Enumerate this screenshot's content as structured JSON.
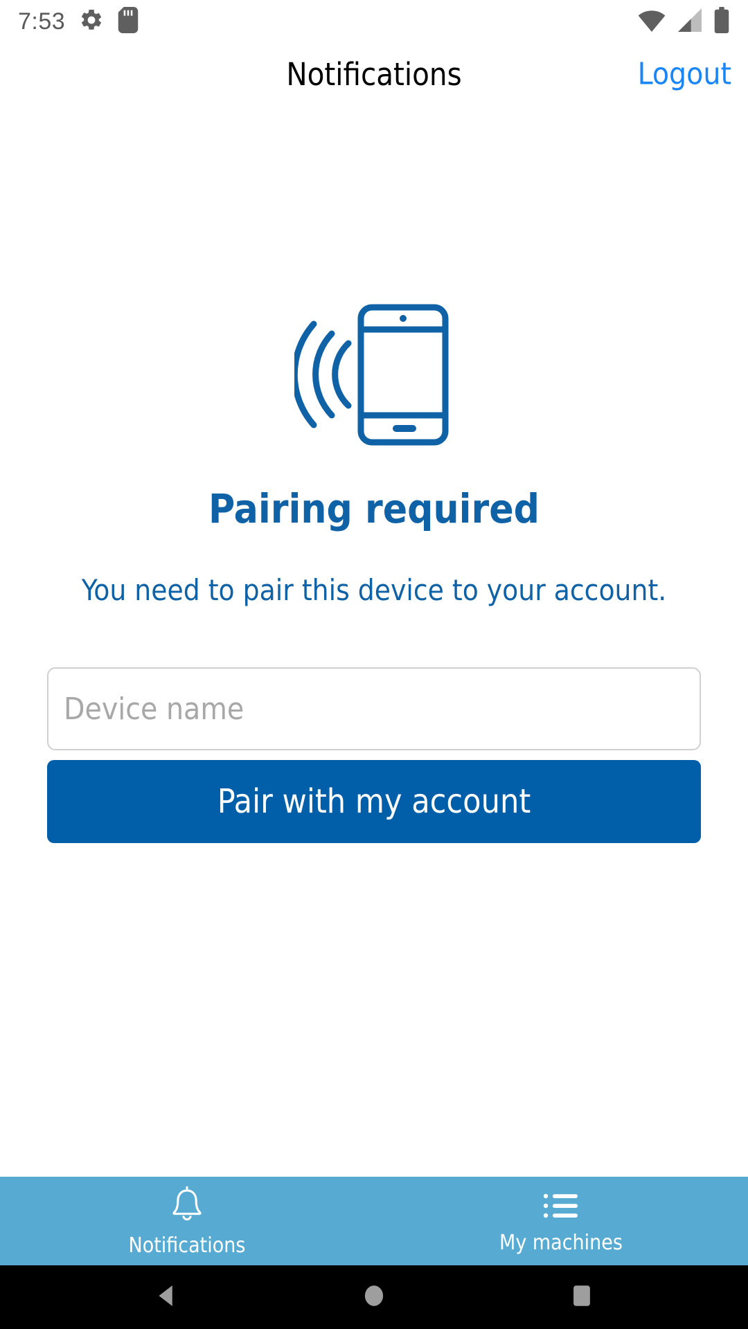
{
  "status_bar": {
    "time": "7:53",
    "icons": [
      "gear-icon",
      "sd-card-icon",
      "wifi-icon",
      "cellular-signal-icon",
      "battery-icon"
    ]
  },
  "header": {
    "title": "Notifications",
    "logout_label": "Logout",
    "logout_color": "#1886f7"
  },
  "main": {
    "illustration": "phone-with-signal-waves-icon",
    "headline": "Pairing required",
    "subtext": "You need to pair this device to your account.",
    "device_name_value": "",
    "device_name_placeholder": "Device name",
    "pair_button_label": "Pair with my account"
  },
  "tab_bar": {
    "background": "#57abd2",
    "tabs": [
      {
        "label": "Notifications",
        "icon": "bell-icon",
        "active": true
      },
      {
        "label": "My machines",
        "icon": "list-icon",
        "active": false
      }
    ]
  },
  "nav_bar": {
    "buttons": [
      "back-icon",
      "home-icon",
      "recents-icon"
    ]
  },
  "colors": {
    "brand_blue": "#005fa8",
    "text_blue": "#0f62a6",
    "tab_blue": "#57abd2",
    "link_blue": "#1886f7"
  }
}
